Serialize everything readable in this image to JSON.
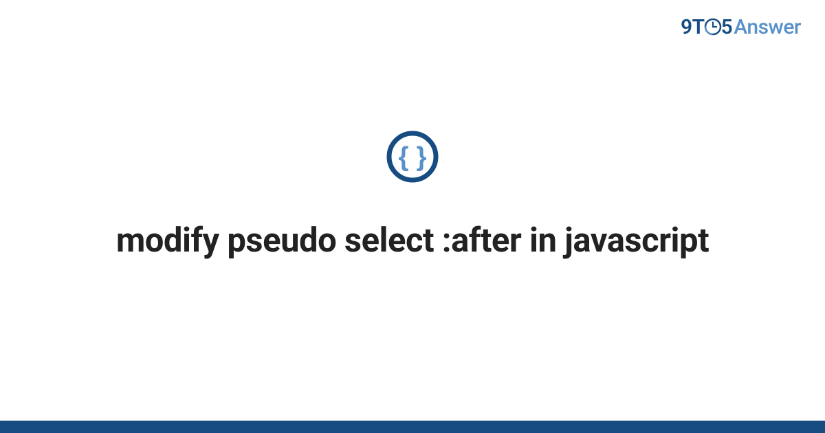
{
  "logo": {
    "part1": "9T",
    "part2": "5",
    "part3": "Answer"
  },
  "title": "modify pseudo select :after in javascript",
  "colors": {
    "darkBlue": "#164c82",
    "lightBlue": "#5891c9",
    "accentBlue": "#4a86c5"
  }
}
